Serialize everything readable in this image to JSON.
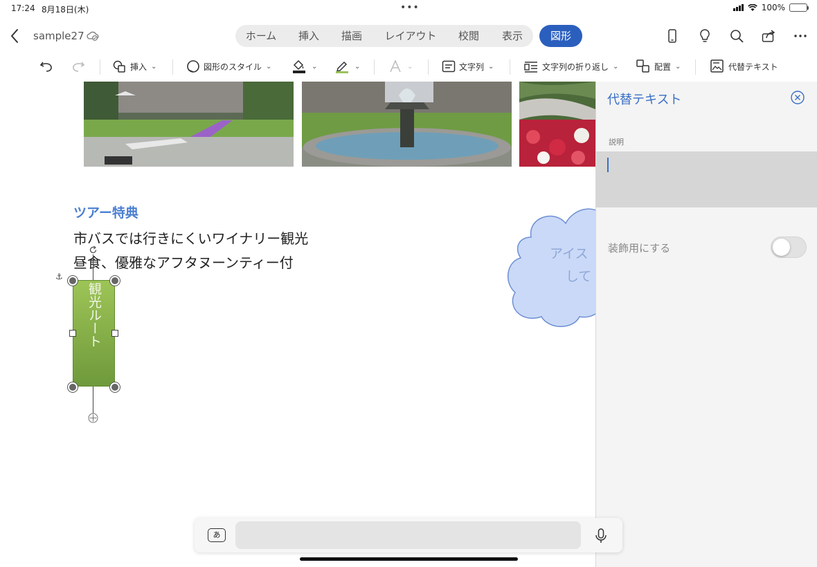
{
  "status": {
    "time": "17:24",
    "date": "8月18日(木)",
    "battery": "100%"
  },
  "titlebar": {
    "doc_name": "sample27"
  },
  "tabs": [
    {
      "label": "ホーム"
    },
    {
      "label": "挿入"
    },
    {
      "label": "描画"
    },
    {
      "label": "レイアウト"
    },
    {
      "label": "校閲"
    },
    {
      "label": "表示"
    }
  ],
  "active_tab": "図形",
  "ribbon": {
    "insert": "挿入",
    "shape_style": "図形のスタイル",
    "text_direction": "文字列",
    "wrap_text": "文字列の折り返し",
    "arrange": "配置",
    "alt_text": "代替テキスト"
  },
  "document": {
    "heading": "ツアー特典",
    "line1": "市バスでは行きにくいワイナリー観光",
    "line2": "昼食、優雅なアフタヌーンティー付",
    "shape_text": "観光ルート",
    "cloud_text_1": "アイス",
    "cloud_text_2": "して"
  },
  "pane": {
    "title": "代替テキスト",
    "description_label": "説明",
    "description_value": "",
    "decorative_label": "装飾用にする",
    "decorative_on": false
  },
  "colors": {
    "accent": "#2b5fbe",
    "heading": "#4a7fd0",
    "shape_green": "#8cb94d"
  }
}
